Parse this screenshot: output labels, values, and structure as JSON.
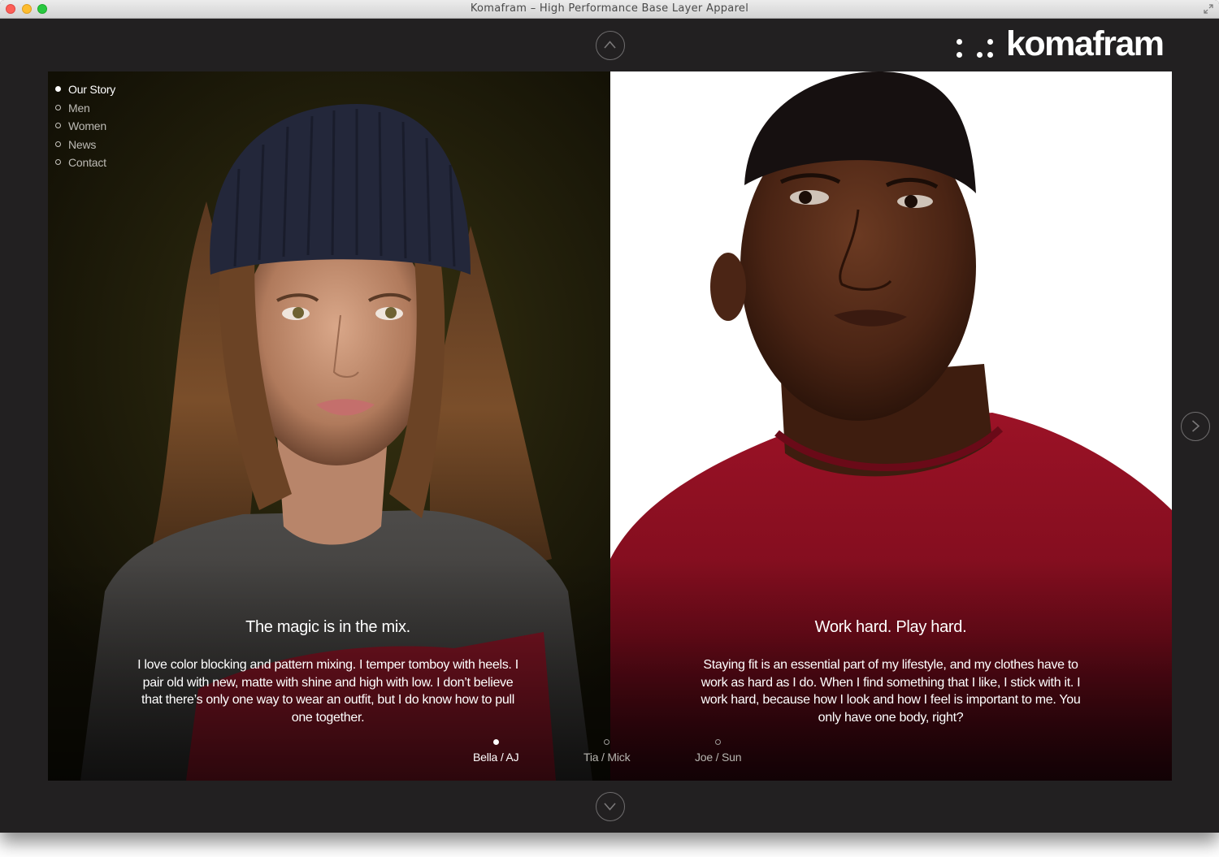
{
  "window": {
    "title": "Komafram – High Performance Base Layer Apparel"
  },
  "brand": {
    "logo_text": "komafram"
  },
  "nav": {
    "items": [
      {
        "label": "Our Story",
        "active": true
      },
      {
        "label": "Men",
        "active": false
      },
      {
        "label": "Women",
        "active": false
      },
      {
        "label": "News",
        "active": false
      },
      {
        "label": "Contact",
        "active": false
      }
    ]
  },
  "slides": {
    "left": {
      "headline": "The magic is in the mix.",
      "body": "I love color blocking and pattern mixing. I temper tomboy with heels. I pair old with new, matte with shine and high with low. I don’t believe that there’s only one way to wear an outfit, but I do know how to pull one together."
    },
    "right": {
      "headline": "Work hard. Play hard.",
      "body": "Staying fit is an essential part of my lifestyle, and my clothes have to work as hard as I do. When I find something that I like, I stick with it. I work hard, because how I look and how I feel is important to me. You only have one body, right?"
    }
  },
  "pager": {
    "items": [
      {
        "label": "Bella / AJ",
        "active": true
      },
      {
        "label": "Tia / Mick",
        "active": false
      },
      {
        "label": "Joe / Sun",
        "active": false
      }
    ]
  },
  "icons": {
    "up": "chevron-up-icon",
    "down": "chevron-down-icon",
    "next": "chevron-right-icon"
  },
  "colors": {
    "background": "#222021",
    "text": "#ffffff",
    "nav_inactive": "#bdbbb5",
    "shirt_red": "#8f1022"
  }
}
